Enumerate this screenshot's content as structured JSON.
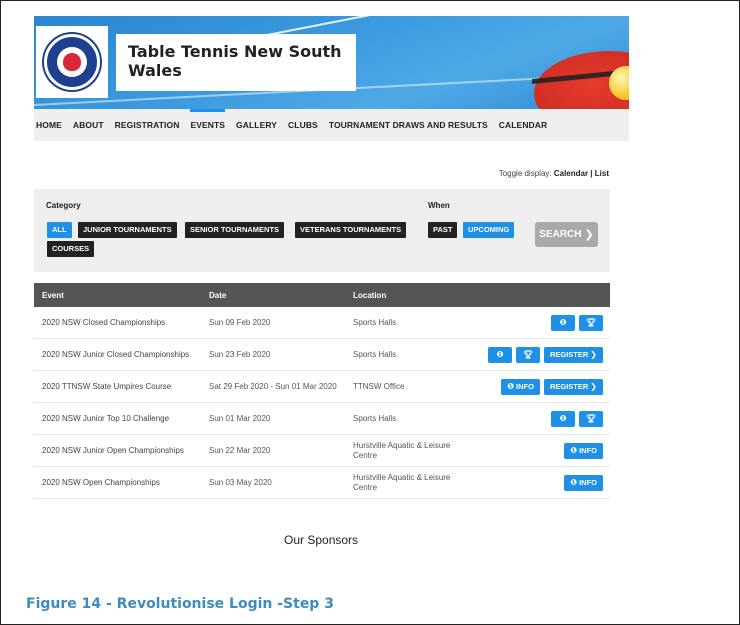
{
  "site": {
    "title": "Table Tennis New South Wales",
    "title_line1": "Table Tennis New South",
    "title_line2": "Wales"
  },
  "nav": {
    "items": [
      {
        "label": "HOME",
        "active": false
      },
      {
        "label": "ABOUT",
        "active": false
      },
      {
        "label": "REGISTRATION",
        "active": false
      },
      {
        "label": "EVENTS",
        "active": true
      },
      {
        "label": "GALLERY",
        "active": false
      },
      {
        "label": "CLUBS",
        "active": false
      },
      {
        "label": "TOURNAMENT DRAWS AND RESULTS",
        "active": false
      },
      {
        "label": "CALENDAR",
        "active": false
      }
    ]
  },
  "toggle": {
    "prefix": "Toggle display: ",
    "calendar": "Calendar",
    "separator": " | ",
    "list": "List"
  },
  "filter": {
    "category_label": "Category",
    "when_label": "When",
    "categories": [
      "ALL",
      "JUNIOR TOURNAMENTS",
      "SENIOR TOURNAMENTS",
      "VETERANS TOURNAMENTS",
      "COURSES"
    ],
    "selected_category": "ALL",
    "when_options": [
      "PAST",
      "UPCOMING"
    ],
    "selected_when": "UPCOMING",
    "search_label": "SEARCH",
    "search_icon": "chevron-right-icon"
  },
  "table": {
    "headers": {
      "event": "Event",
      "date": "Date",
      "location": "Location"
    },
    "rows": [
      {
        "event": "2020 NSW Closed Championships",
        "date": "Sun 09 Feb 2020",
        "location": "Sports Halls",
        "actions": [
          "info-icon",
          "trophy-icon"
        ]
      },
      {
        "event": "2020 NSW Junior Closed Championships",
        "date": "Sun 23 Feb 2020",
        "location": "Sports Halls",
        "actions": [
          "info-icon",
          "trophy-icon",
          "REGISTER"
        ]
      },
      {
        "event": "2020 TTNSW State Umpires Course",
        "date": "Sat 29 Feb 2020 - Sun 01 Mar 2020",
        "location": "TTNSW Office",
        "actions": [
          "INFO",
          "REGISTER"
        ]
      },
      {
        "event": "2020 NSW Junior Top 10 Challenge",
        "date": "Sun 01 Mar 2020",
        "location": "Sports Halls",
        "actions": [
          "info-icon",
          "trophy-icon"
        ]
      },
      {
        "event": "2020 NSW Junior Open Championships",
        "date": "Sun 22 Mar 2020",
        "location": "Hurstville Aquatic & Leisure Centre",
        "actions": [
          "INFO"
        ]
      },
      {
        "event": "2020 NSW Open Championships",
        "date": "Sun 03 May 2020",
        "location": "Hurstville Aquatic & Leisure Centre",
        "actions": [
          "INFO"
        ]
      }
    ]
  },
  "buttons": {
    "info": "INFO",
    "register": "REGISTER"
  },
  "sponsors_heading": "Our Sponsors",
  "caption": "Figure 14 - Revolutionise Login -Step 3",
  "colors": {
    "accent": "#1e90e6",
    "dark_chip": "#222222",
    "header_row": "#555555",
    "caption": "#3e8bbf"
  }
}
